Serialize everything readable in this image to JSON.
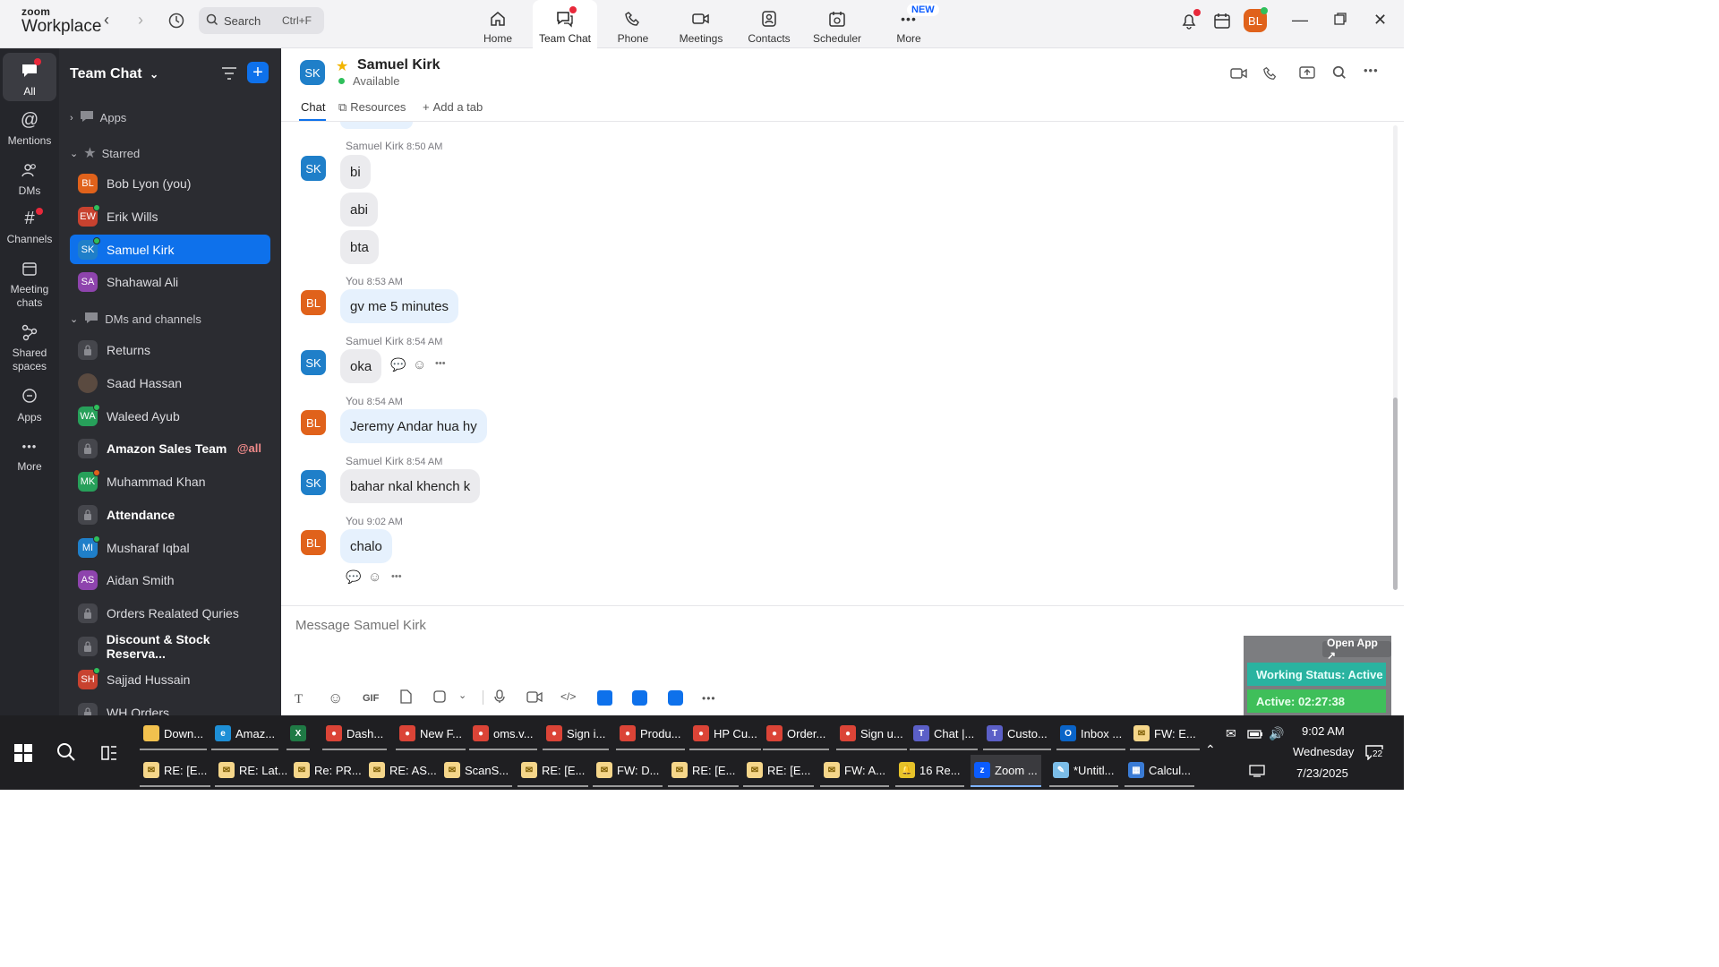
{
  "app": {
    "logo_top": "zoom",
    "logo_bottom": "Workplace"
  },
  "search": {
    "label": "Search",
    "shortcut": "Ctrl+F"
  },
  "top_tabs": [
    {
      "label": "Home"
    },
    {
      "label": "Team Chat"
    },
    {
      "label": "Phone"
    },
    {
      "label": "Meetings"
    },
    {
      "label": "Contacts"
    },
    {
      "label": "Scheduler"
    },
    {
      "label": "More",
      "badge": "NEW"
    }
  ],
  "user_avatar": "BL",
  "rail": [
    {
      "label": "All"
    },
    {
      "label": "Mentions"
    },
    {
      "label": "DMs"
    },
    {
      "label": "Channels"
    },
    {
      "label": "Meeting chats"
    },
    {
      "label": "Shared spaces"
    },
    {
      "label": "Apps"
    },
    {
      "label": "More"
    }
  ],
  "sidebar": {
    "title": "Team Chat",
    "apps_label": "Apps",
    "starred_label": "Starred",
    "starred": [
      {
        "initials": "BL",
        "name": "Bob Lyon (you)",
        "color": "#e0621b"
      },
      {
        "initials": "EW",
        "name": "Erik Wills",
        "color": "#c8422f"
      },
      {
        "initials": "SK",
        "name": "Samuel Kirk",
        "color": "#1f7fc9"
      },
      {
        "initials": "SA",
        "name": "Shahawal Ali",
        "color": "#8e44ad"
      }
    ],
    "dms_label": "DMs and channels",
    "dms": [
      {
        "type": "lock",
        "name": "Returns"
      },
      {
        "type": "photo",
        "name": "Saad Hassan"
      },
      {
        "initials": "WA",
        "name": "Waleed Ayub",
        "color": "#27a05a"
      },
      {
        "type": "lock",
        "name": "Amazon Sales Team",
        "bold": true,
        "tag": "@all"
      },
      {
        "initials": "MK",
        "name": "Muhammad Khan",
        "color": "#27a05a"
      },
      {
        "type": "lock",
        "name": "Attendance",
        "bold": true
      },
      {
        "initials": "MI",
        "name": "Musharaf Iqbal",
        "color": "#1f7fc9"
      },
      {
        "initials": "AS",
        "name": "Aidan Smith",
        "color": "#8e44ad"
      },
      {
        "type": "lock",
        "name": "Orders Realated Quries"
      },
      {
        "type": "lock",
        "name": "Discount & Stock Reserva...",
        "bold": true
      },
      {
        "initials": "SH",
        "name": "Sajjad Hussain",
        "color": "#c8422f"
      },
      {
        "type": "lock",
        "name": "WH Orders"
      }
    ]
  },
  "chat_header": {
    "initials": "SK",
    "name": "Samuel Kirk",
    "status": "Available",
    "tabs": [
      {
        "label": "Chat"
      },
      {
        "label": "Resources"
      },
      {
        "label": "Add a tab"
      }
    ]
  },
  "messages": [
    {
      "sender": "Samuel Kirk",
      "time": "8:50 AM",
      "initials": "SK",
      "color": "#1f7fc9",
      "texts": [
        "bi",
        "abi",
        "bta"
      ]
    },
    {
      "sender": "You",
      "time": "8:53 AM",
      "initials": "BL",
      "color": "#e0621b",
      "texts": [
        "gv me 5 minutes"
      ]
    },
    {
      "sender": "Samuel Kirk",
      "time": "8:54 AM",
      "initials": "SK",
      "color": "#1f7fc9",
      "texts": [
        "oka"
      ]
    },
    {
      "sender": "You",
      "time": "8:54 AM",
      "initials": "BL",
      "color": "#e0621b",
      "texts": [
        "Jeremy Andar hua hy"
      ]
    },
    {
      "sender": "Samuel Kirk",
      "time": "8:54 AM",
      "initials": "SK",
      "color": "#1f7fc9",
      "texts": [
        "bahar nkal khench k"
      ]
    },
    {
      "sender": "You",
      "time": "9:02 AM",
      "initials": "BL",
      "color": "#e0621b",
      "texts": [
        "chalo"
      ]
    }
  ],
  "composer": {
    "placeholder": "Message Samuel Kirk",
    "gif_label": "GIF"
  },
  "widget": {
    "open_app": "Open App ↗",
    "working_status": "Working Status: Active",
    "active_timer": "Active: 02:27:38"
  },
  "taskbar": {
    "row1": [
      {
        "label": "Down...",
        "icon": "folder"
      },
      {
        "label": "Amaz...",
        "icon": "edge"
      },
      {
        "label": "",
        "icon": "excel"
      },
      {
        "label": "Dash...",
        "icon": "chrome"
      },
      {
        "label": "New F...",
        "icon": "chrome"
      },
      {
        "label": "oms.v...",
        "icon": "chrome"
      },
      {
        "label": "Sign i...",
        "icon": "chrome"
      },
      {
        "label": "Produ...",
        "icon": "chrome"
      },
      {
        "label": "HP Cu...",
        "icon": "chrome"
      },
      {
        "label": "Order...",
        "icon": "chrome"
      },
      {
        "label": "Sign u...",
        "icon": "chrome"
      },
      {
        "label": "Chat |...",
        "icon": "teams"
      },
      {
        "label": "Custo...",
        "icon": "teams"
      },
      {
        "label": "Inbox ...",
        "icon": "outlook"
      },
      {
        "label": "FW: E...",
        "icon": "mail"
      }
    ],
    "row2": [
      {
        "label": "RE: [E...",
        "icon": "mail"
      },
      {
        "label": "RE: Lat...",
        "icon": "mail"
      },
      {
        "label": "Re: PR...",
        "icon": "mail"
      },
      {
        "label": "RE: AS...",
        "icon": "mail"
      },
      {
        "label": "ScanS...",
        "icon": "mail"
      },
      {
        "label": "RE: [E...",
        "icon": "mail"
      },
      {
        "label": "FW: D...",
        "icon": "mail"
      },
      {
        "label": "RE: [E...",
        "icon": "mail"
      },
      {
        "label": "RE: [E...",
        "icon": "mail"
      },
      {
        "label": "FW: A...",
        "icon": "mail"
      },
      {
        "label": "16 Re...",
        "icon": "bell"
      },
      {
        "label": "Zoom ...",
        "icon": "zoom"
      },
      {
        "label": "*Untitl...",
        "icon": "notepad"
      },
      {
        "label": "Calcul...",
        "icon": "calc"
      }
    ],
    "time": "9:02 AM",
    "day": "Wednesday",
    "date": "7/23/2025",
    "notif_count": "22"
  }
}
